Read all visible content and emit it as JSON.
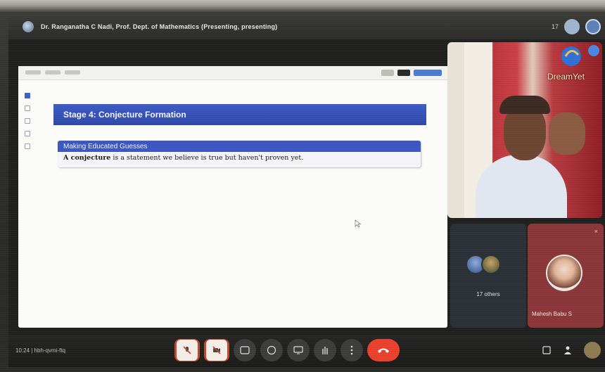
{
  "meeting": {
    "presenter_title": "Dr. Ranganatha C Nadi, Prof. Dept. of Mathematics (Presenting, presenting)",
    "top_right_label": "17"
  },
  "slide": {
    "heading": "Stage 4: Conjecture Formation",
    "block_title": "Making Educated Guesses",
    "block_term": "A conjecture",
    "block_rest": "is a statement we believe is true but haven't proven yet."
  },
  "tiles": {
    "brand": "DreamYet",
    "others_label": "17 others",
    "participant_name": "Mahesh Babu S",
    "participant_close": "×"
  },
  "bottombar": {
    "meeting_info": "10:24  |  hbh-qvmi-ftq"
  },
  "colors": {
    "slide_heading_bg": "#3d5bc6",
    "end_call": "#e8402c",
    "participant_tile": "#8a3538"
  }
}
